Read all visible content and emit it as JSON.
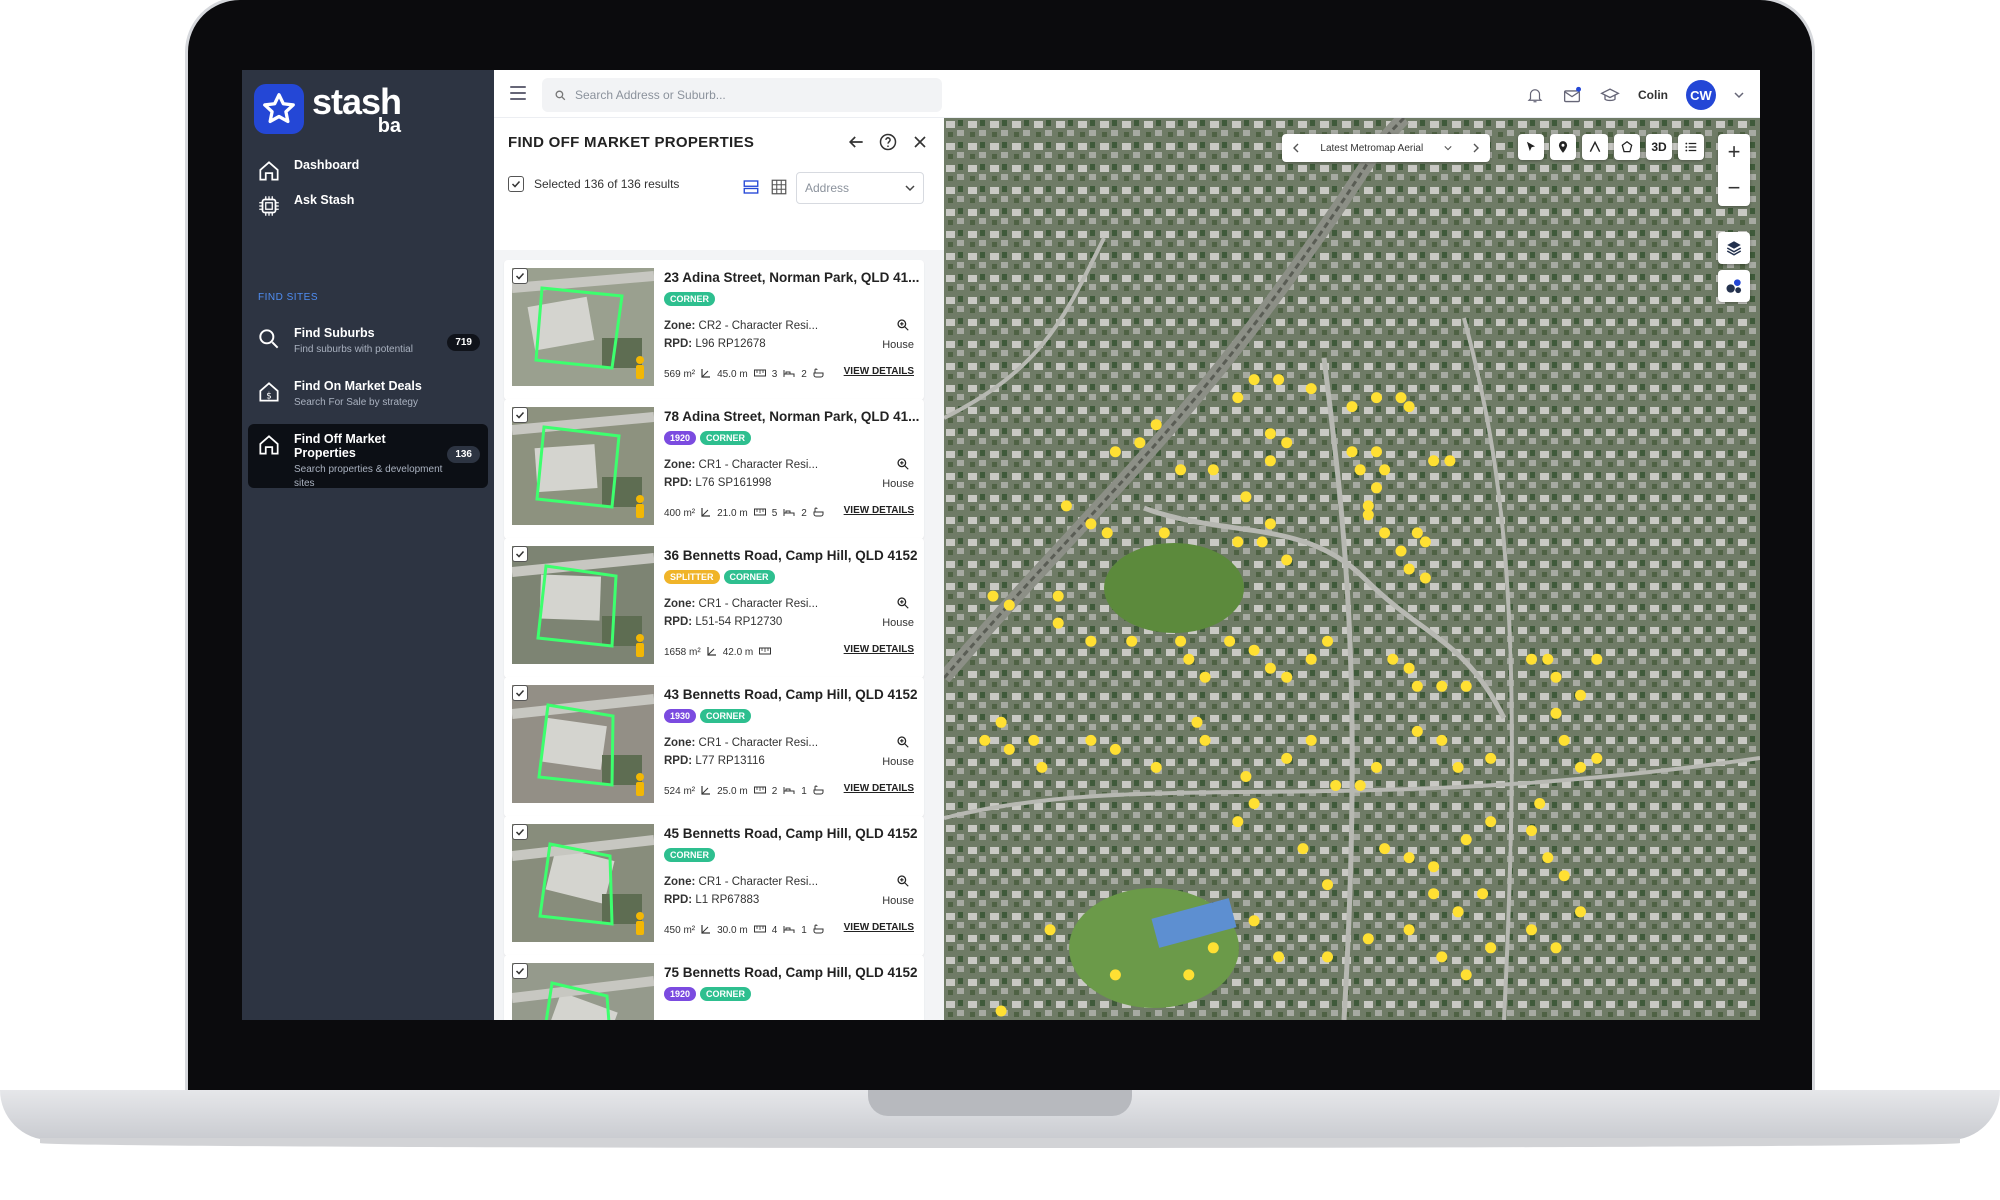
{
  "brand": {
    "name": "stash",
    "sub": "ba",
    "accent": "#2447d6"
  },
  "sidebar": {
    "items": [
      {
        "label": "Dashboard",
        "icon": "home-icon"
      },
      {
        "label": "Ask Stash",
        "icon": "chip-icon"
      }
    ],
    "section_title": "FIND SITES",
    "find_items": [
      {
        "label": "Find Suburbs",
        "sub": "Find suburbs with potential",
        "count": "719",
        "icon": "search-icon"
      },
      {
        "label": "Find On Market Deals",
        "sub": "Search For Sale by strategy",
        "icon": "house-dollar-icon"
      },
      {
        "label": "Find Off Market Properties",
        "sub": "Search properties & development sites",
        "count": "136",
        "icon": "house-icon",
        "active": true
      }
    ]
  },
  "topbar": {
    "search_placeholder": "Search Address or Suburb...",
    "user_name": "Colin",
    "user_initials": "CW"
  },
  "panel": {
    "title": "FIND OFF MARKET PROPERTIES",
    "selected_text": "Selected 136 of 136 results",
    "sort_value": "Address",
    "cards": [
      {
        "address": "23 Adina Street, Norman Park, QLD 41...",
        "tags": [
          {
            "t": "CORNER",
            "k": "corner"
          }
        ],
        "zone": "CR2 - Character Resi...",
        "rpd": "L96 RP12678",
        "type": "House",
        "area": "569 m²",
        "frontage": "45.0 m",
        "beds": "3",
        "baths": "2",
        "details": "VIEW DETAILS"
      },
      {
        "address": "78 Adina Street, Norman Park, QLD 41...",
        "tags": [
          {
            "t": "1920",
            "k": "year"
          },
          {
            "t": "CORNER",
            "k": "corner"
          }
        ],
        "zone": "CR1 - Character Resi...",
        "rpd": "L76 SP161998",
        "type": "House",
        "area": "400 m²",
        "frontage": "21.0 m",
        "beds": "5",
        "baths": "2",
        "details": "VIEW DETAILS"
      },
      {
        "address": "36 Bennetts Road, Camp Hill, QLD 4152",
        "tags": [
          {
            "t": "SPLITTER",
            "k": "splitter"
          },
          {
            "t": "CORNER",
            "k": "corner"
          }
        ],
        "zone": "CR1 - Character Resi...",
        "rpd": "L51-54 RP12730",
        "type": "House",
        "area": "1658 m²",
        "frontage": "42.0 m",
        "beds": "",
        "baths": "",
        "details": "VIEW DETAILS"
      },
      {
        "address": "43 Bennetts Road, Camp Hill, QLD 4152",
        "tags": [
          {
            "t": "1930",
            "k": "year"
          },
          {
            "t": "CORNER",
            "k": "corner"
          }
        ],
        "zone": "CR1 - Character Resi...",
        "rpd": "L77 RP13116",
        "type": "House",
        "area": "524 m²",
        "frontage": "25.0 m",
        "beds": "2",
        "baths": "1",
        "details": "VIEW DETAILS"
      },
      {
        "address": "45 Bennetts Road, Camp Hill, QLD 4152",
        "tags": [
          {
            "t": "CORNER",
            "k": "corner"
          }
        ],
        "zone": "CR1 - Character Resi...",
        "rpd": "L1 RP67883",
        "type": "House",
        "area": "450 m²",
        "frontage": "30.0 m",
        "beds": "4",
        "baths": "1",
        "details": "VIEW DETAILS"
      },
      {
        "address": "75 Bennetts Road, Camp Hill, QLD 4152",
        "tags": [
          {
            "t": "1920",
            "k": "year"
          },
          {
            "t": "CORNER",
            "k": "corner"
          }
        ],
        "zone": "",
        "rpd": "",
        "type": "",
        "area": "",
        "frontage": "",
        "beds": "",
        "baths": "",
        "details": ""
      }
    ],
    "zone_label": "Zone:",
    "rpd_label": "RPD:"
  },
  "map": {
    "layer": "Latest Metromap Aerial",
    "tool_3d": "3D",
    "marker_color": "#ffe033",
    "markers": [
      [
        0.38,
        0.29
      ],
      [
        0.36,
        0.31
      ],
      [
        0.41,
        0.29
      ],
      [
        0.45,
        0.3
      ],
      [
        0.5,
        0.32
      ],
      [
        0.53,
        0.31
      ],
      [
        0.56,
        0.31
      ],
      [
        0.57,
        0.32
      ],
      [
        0.26,
        0.34
      ],
      [
        0.24,
        0.36
      ],
      [
        0.21,
        0.37
      ],
      [
        0.29,
        0.39
      ],
      [
        0.33,
        0.39
      ],
      [
        0.4,
        0.35
      ],
      [
        0.42,
        0.36
      ],
      [
        0.4,
        0.38
      ],
      [
        0.5,
        0.37
      ],
      [
        0.51,
        0.39
      ],
      [
        0.53,
        0.37
      ],
      [
        0.54,
        0.39
      ],
      [
        0.6,
        0.38
      ],
      [
        0.62,
        0.38
      ],
      [
        0.15,
        0.43
      ],
      [
        0.18,
        0.45
      ],
      [
        0.2,
        0.46
      ],
      [
        0.27,
        0.46
      ],
      [
        0.37,
        0.42
      ],
      [
        0.4,
        0.45
      ],
      [
        0.39,
        0.47
      ],
      [
        0.36,
        0.47
      ],
      [
        0.42,
        0.49
      ],
      [
        0.52,
        0.43
      ],
      [
        0.53,
        0.41
      ],
      [
        0.52,
        0.44
      ],
      [
        0.54,
        0.46
      ],
      [
        0.56,
        0.48
      ],
      [
        0.58,
        0.46
      ],
      [
        0.59,
        0.47
      ],
      [
        0.57,
        0.5
      ],
      [
        0.59,
        0.51
      ],
      [
        0.06,
        0.53
      ],
      [
        0.08,
        0.54
      ],
      [
        0.14,
        0.53
      ],
      [
        0.14,
        0.56
      ],
      [
        0.18,
        0.58
      ],
      [
        0.23,
        0.58
      ],
      [
        0.29,
        0.58
      ],
      [
        0.3,
        0.6
      ],
      [
        0.32,
        0.62
      ],
      [
        0.35,
        0.58
      ],
      [
        0.38,
        0.59
      ],
      [
        0.4,
        0.61
      ],
      [
        0.42,
        0.62
      ],
      [
        0.45,
        0.6
      ],
      [
        0.47,
        0.58
      ],
      [
        0.55,
        0.6
      ],
      [
        0.57,
        0.61
      ],
      [
        0.58,
        0.63
      ],
      [
        0.61,
        0.63
      ],
      [
        0.64,
        0.63
      ],
      [
        0.72,
        0.6
      ],
      [
        0.74,
        0.6
      ],
      [
        0.75,
        0.62
      ],
      [
        0.78,
        0.64
      ],
      [
        0.8,
        0.6
      ],
      [
        0.75,
        0.66
      ],
      [
        0.07,
        0.67
      ],
      [
        0.05,
        0.69
      ],
      [
        0.08,
        0.7
      ],
      [
        0.11,
        0.69
      ],
      [
        0.12,
        0.72
      ],
      [
        0.18,
        0.69
      ],
      [
        0.21,
        0.7
      ],
      [
        0.26,
        0.72
      ],
      [
        0.31,
        0.67
      ],
      [
        0.32,
        0.69
      ],
      [
        0.37,
        0.73
      ],
      [
        0.42,
        0.71
      ],
      [
        0.45,
        0.69
      ],
      [
        0.48,
        0.74
      ],
      [
        0.51,
        0.74
      ],
      [
        0.53,
        0.72
      ],
      [
        0.58,
        0.68
      ],
      [
        0.61,
        0.69
      ],
      [
        0.63,
        0.72
      ],
      [
        0.67,
        0.71
      ],
      [
        0.76,
        0.69
      ],
      [
        0.78,
        0.72
      ],
      [
        0.8,
        0.71
      ],
      [
        0.73,
        0.76
      ],
      [
        0.38,
        0.76
      ],
      [
        0.36,
        0.78
      ],
      [
        0.44,
        0.81
      ],
      [
        0.47,
        0.85
      ],
      [
        0.54,
        0.81
      ],
      [
        0.57,
        0.82
      ],
      [
        0.6,
        0.83
      ],
      [
        0.64,
        0.8
      ],
      [
        0.67,
        0.78
      ],
      [
        0.72,
        0.79
      ],
      [
        0.74,
        0.82
      ],
      [
        0.76,
        0.84
      ],
      [
        0.6,
        0.86
      ],
      [
        0.63,
        0.88
      ],
      [
        0.66,
        0.86
      ],
      [
        0.57,
        0.9
      ],
      [
        0.52,
        0.91
      ],
      [
        0.47,
        0.93
      ],
      [
        0.38,
        0.89
      ],
      [
        0.41,
        0.93
      ],
      [
        0.33,
        0.92
      ],
      [
        0.3,
        0.95
      ],
      [
        0.21,
        0.95
      ],
      [
        0.13,
        0.9
      ],
      [
        0.07,
        0.99
      ],
      [
        0.61,
        0.93
      ],
      [
        0.64,
        0.95
      ],
      [
        0.67,
        0.92
      ],
      [
        0.72,
        0.9
      ],
      [
        0.75,
        0.92
      ],
      [
        0.78,
        0.88
      ]
    ]
  }
}
